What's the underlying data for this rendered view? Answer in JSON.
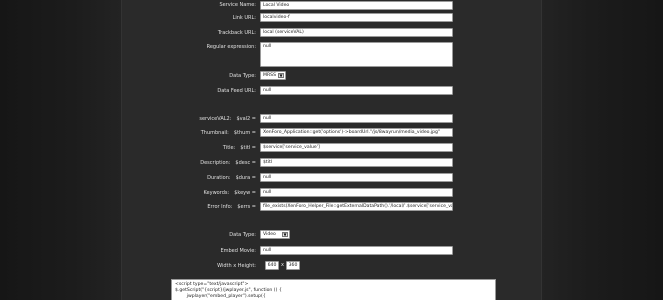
{
  "form": {
    "service_name": {
      "label": "Service Name:",
      "value": "Local Video"
    },
    "link_url": {
      "label": "Link URL:",
      "value": "localvideo-f"
    },
    "trackback_url": {
      "label": "Trackback URL:",
      "value": "local (serviceVAL)"
    },
    "regex": {
      "label": "Regular expression:",
      "value": "null"
    },
    "data_type": {
      "label": "Data Type:",
      "value": "MRSS"
    },
    "data_feed_url": {
      "label": "Data Feed URL:",
      "value": "null"
    },
    "servicevals": {
      "label": "serviceVAL2:",
      "var": "$val2 =",
      "value": "null"
    },
    "thumbnail": {
      "label": "Thumbnail:",
      "var": "$thum =",
      "value": "XenForo_Application::get('options')->boardUrl.\"/js/8wayrun/media_video.jpg\""
    },
    "title": {
      "label": "Title:",
      "var": "$titl =",
      "value": "$service['service_value']"
    },
    "description": {
      "label": "Description:",
      "var": "$desc =",
      "value": "$titl"
    },
    "duration": {
      "label": "Duration:",
      "var": "$dura =",
      "value": "null"
    },
    "keywords": {
      "label": "Keywords:",
      "var": "$keyw =",
      "value": "null"
    },
    "error_info": {
      "label": "Error Info:",
      "var": "$errs =",
      "value": "file_exists(XenForo_Helper_File::getExternalDataPath().'/local/'.$service['service_value'])"
    },
    "data_type2": {
      "label": "Data Type:",
      "value": "Video"
    },
    "embed_movie": {
      "label": "Embed Movie:",
      "value": "null"
    },
    "width_height": {
      "label": "Width x Height:",
      "width": "640",
      "sep": "x",
      "height": "360"
    },
    "embed_code": {
      "lines": [
        "<script type=\"text/javascript\">",
        "$.getScript(\"{script}/jwplayer.js\", function () {",
        "        jwplayer(\"embed_player\").setup({"
      ]
    }
  },
  "icons": {
    "dropdown_arrow": "triangle-down"
  }
}
